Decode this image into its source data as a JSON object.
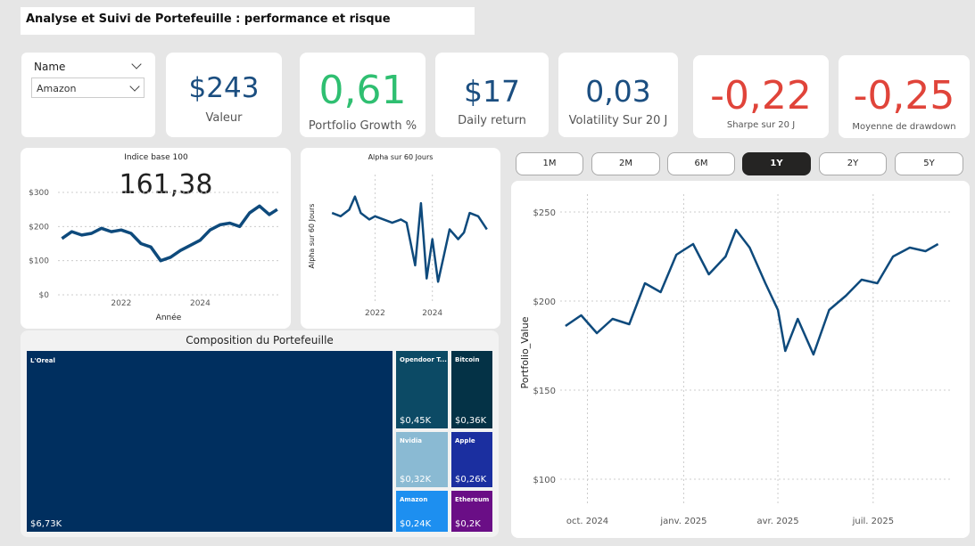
{
  "title": "Analyse et Suivi de Portefeuille : performance et risque",
  "slicer": {
    "label": "Name",
    "selected": "Amazon"
  },
  "kpis": [
    {
      "value": "$243",
      "label": "Valeur",
      "color": "#1b4e80"
    },
    {
      "value": "0,61",
      "label": "Portfolio Growth %",
      "color": "#2fbf71"
    },
    {
      "value": "$17",
      "label": "Daily return",
      "color": "#1b4e80"
    },
    {
      "value": "0,03",
      "label": "Volatility Sur 20 J",
      "color": "#1b4e80"
    },
    {
      "value": "-0,22",
      "label": "Sharpe sur 20 J",
      "color": "#e0443a"
    },
    {
      "value": "-0,25",
      "label": "Moyenne de drawdown",
      "color": "#e0443a"
    }
  ],
  "time_buttons": [
    "1M",
    "2M",
    "6M",
    "1Y",
    "2Y",
    "5Y"
  ],
  "active_button": "1Y",
  "treemap": {
    "title": "Composition du Portefeuille",
    "items": [
      {
        "name": "L'Oreal",
        "value": "$6,73K",
        "color": "#002f5f"
      },
      {
        "name": "Opendoor T...",
        "value": "$0,45K",
        "color": "#0c4a65"
      },
      {
        "name": "Bitcoin",
        "value": "$0,36K",
        "color": "#043246"
      },
      {
        "name": "Nvidia",
        "value": "$0,32K",
        "color": "#8abad3"
      },
      {
        "name": "Apple",
        "value": "$0,26K",
        "color": "#1b2fa0"
      },
      {
        "name": "Amazon",
        "value": "$0,24K",
        "color": "#1d8ff0"
      },
      {
        "name": "Ethereum",
        "value": "$0,2K",
        "color": "#6a0e86"
      }
    ]
  },
  "chart_data": [
    {
      "type": "line",
      "title": "Indice base 100",
      "big_value": "161,38",
      "xlabel": "Année",
      "ylabel": "",
      "ylim": [
        0,
        300
      ],
      "yticks": [
        "$0",
        "$100",
        "$200",
        "$300"
      ],
      "xticks": [
        "2022",
        "2024"
      ],
      "x": [
        2020.5,
        2020.75,
        2021.0,
        2021.25,
        2021.5,
        2021.75,
        2022.0,
        2022.25,
        2022.5,
        2022.75,
        2023.0,
        2023.25,
        2023.5,
        2023.75,
        2024.0,
        2024.25,
        2024.5,
        2024.75,
        2025.0,
        2025.25,
        2025.5,
        2025.75,
        2025.95
      ],
      "values": [
        165,
        185,
        175,
        180,
        195,
        185,
        190,
        180,
        150,
        140,
        100,
        110,
        130,
        145,
        160,
        190,
        205,
        210,
        200,
        240,
        260,
        235,
        250
      ]
    },
    {
      "type": "line",
      "title": "Alpha sur 60 Jours",
      "ylabel": "Alpha sur 60 Jours",
      "xticks": [
        "2022",
        "2024"
      ],
      "x": [
        2020.5,
        2020.8,
        2021.1,
        2021.3,
        2021.5,
        2021.8,
        2022.0,
        2022.3,
        2022.6,
        2022.9,
        2023.1,
        2023.4,
        2023.6,
        2023.8,
        2024.0,
        2024.2,
        2024.4,
        2024.6,
        2024.9,
        2025.1,
        2025.3,
        2025.6,
        2025.9
      ],
      "values": [
        0.6,
        0.55,
        0.65,
        0.85,
        0.6,
        0.5,
        0.55,
        0.5,
        0.45,
        0.5,
        0.45,
        -0.2,
        0.75,
        -0.4,
        0.2,
        -0.45,
        -0.05,
        0.35,
        0.2,
        0.3,
        0.6,
        0.55,
        0.35
      ]
    },
    {
      "type": "line",
      "title": "",
      "ylabel": "Portfolio_Value",
      "ylim": [
        90,
        255
      ],
      "yticks": [
        "$100",
        "$150",
        "$200",
        "$250"
      ],
      "xticks": [
        "oct. 2024",
        "janv. 2025",
        "avr. 2025",
        "juil. 2025"
      ],
      "x": [
        "2024-09-10",
        "2024-09-25",
        "2024-10-10",
        "2024-10-25",
        "2024-11-10",
        "2024-11-25",
        "2024-12-10",
        "2024-12-25",
        "2025-01-10",
        "2025-01-25",
        "2025-02-10",
        "2025-02-20",
        "2025-03-05",
        "2025-03-20",
        "2025-04-01",
        "2025-04-08",
        "2025-04-20",
        "2025-05-05",
        "2025-05-20",
        "2025-06-05",
        "2025-06-20",
        "2025-07-05",
        "2025-07-20",
        "2025-08-05",
        "2025-08-20",
        "2025-09-01"
      ],
      "values": [
        186,
        192,
        182,
        190,
        187,
        210,
        205,
        226,
        232,
        215,
        225,
        240,
        230,
        210,
        195,
        172,
        190,
        170,
        195,
        203,
        212,
        210,
        225,
        230,
        228,
        232
      ]
    }
  ]
}
